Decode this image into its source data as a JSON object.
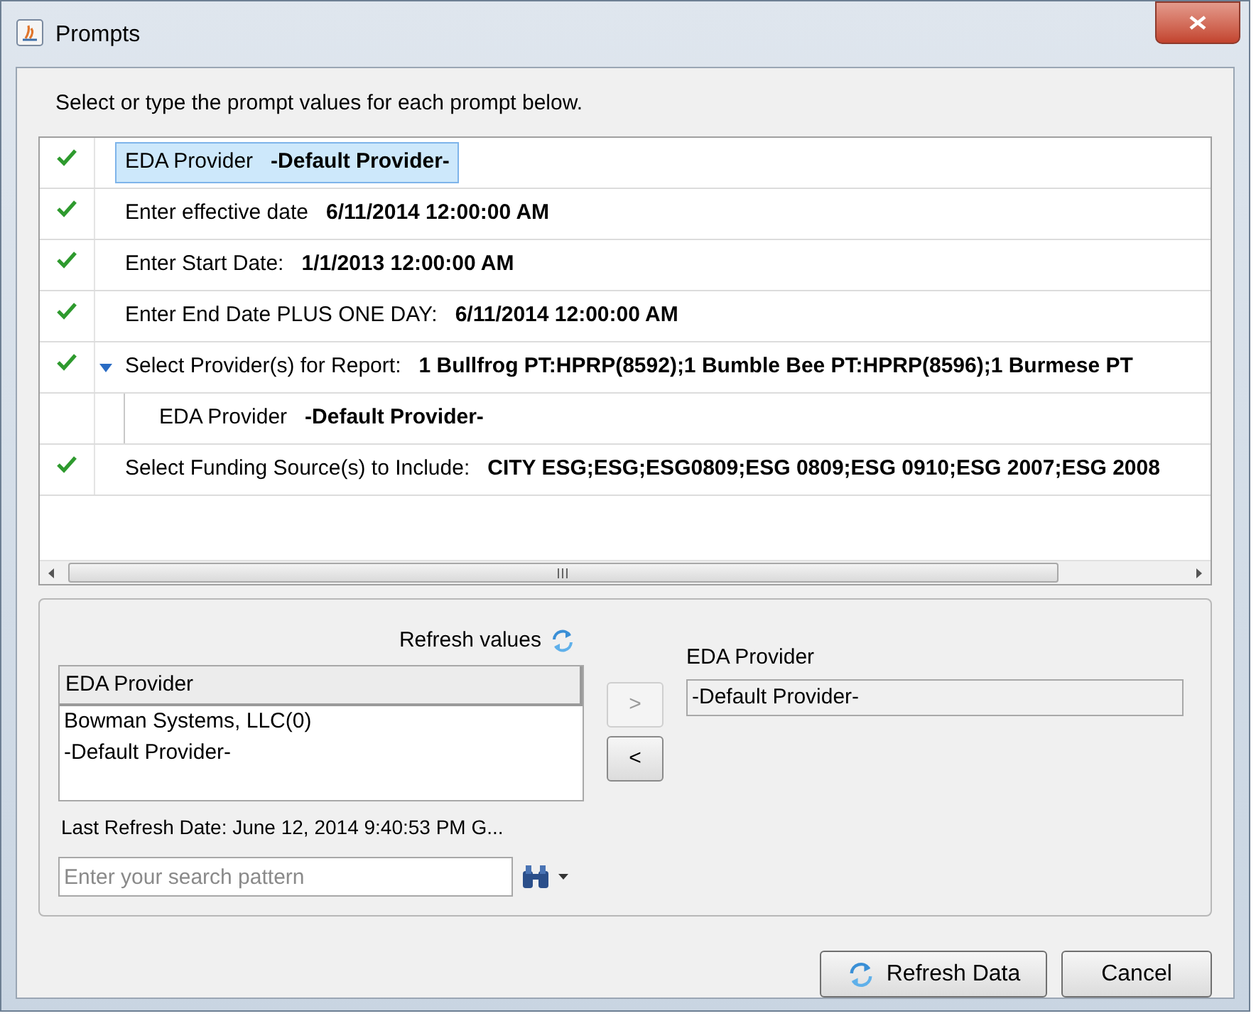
{
  "window": {
    "title": "Prompts"
  },
  "instruction": "Select or type the prompt values for each prompt below.",
  "prompts": [
    {
      "label": "EDA Provider",
      "value": "-Default Provider-",
      "complete": true,
      "selected": true,
      "expanded": false
    },
    {
      "label": "Enter effective date",
      "value": "6/11/2014 12:00:00 AM",
      "complete": true,
      "selected": false,
      "expanded": false
    },
    {
      "label": "Enter Start Date:",
      "value": "1/1/2013 12:00:00 AM",
      "complete": true,
      "selected": false,
      "expanded": false
    },
    {
      "label": "Enter End Date PLUS ONE DAY:",
      "value": "6/11/2014 12:00:00 AM",
      "complete": true,
      "selected": false,
      "expanded": false
    },
    {
      "label": "Select Provider(s) for Report:",
      "value": "1 Bullfrog PT:HPRP(8592);1 Bumble Bee PT:HPRP(8596);1 Burmese PT",
      "complete": true,
      "selected": false,
      "expanded": true,
      "children": [
        {
          "label": "EDA Provider",
          "value": "-Default Provider-",
          "selected": false
        }
      ]
    },
    {
      "label": "Select Funding Source(s) to Include:",
      "value": "CITY ESG;ESG;ESG0809;ESG 0809;ESG 0910;ESG 2007;ESG 2008",
      "complete": true,
      "selected": false,
      "expanded": false
    }
  ],
  "picker": {
    "refresh_label": "Refresh values",
    "list_header": "EDA Provider",
    "options": [
      {
        "text": "Bowman Systems, LLC(0)",
        "selected": false
      },
      {
        "text": "-Default Provider-",
        "selected": false
      }
    ],
    "last_refresh": "Last Refresh Date: June 12, 2014 9:40:53 PM G...",
    "search": {
      "placeholder": "Enter your search pattern"
    },
    "add_button": {
      "text": ">",
      "disabled": true
    },
    "remove_button": {
      "text": "<",
      "disabled": false
    },
    "selected_label": "EDA Provider",
    "selected_values": [
      "-Default Provider-"
    ]
  },
  "buttons": [
    {
      "text": "Refresh Data",
      "kind": "refresh"
    },
    {
      "text": "Cancel",
      "kind": "plain"
    }
  ]
}
